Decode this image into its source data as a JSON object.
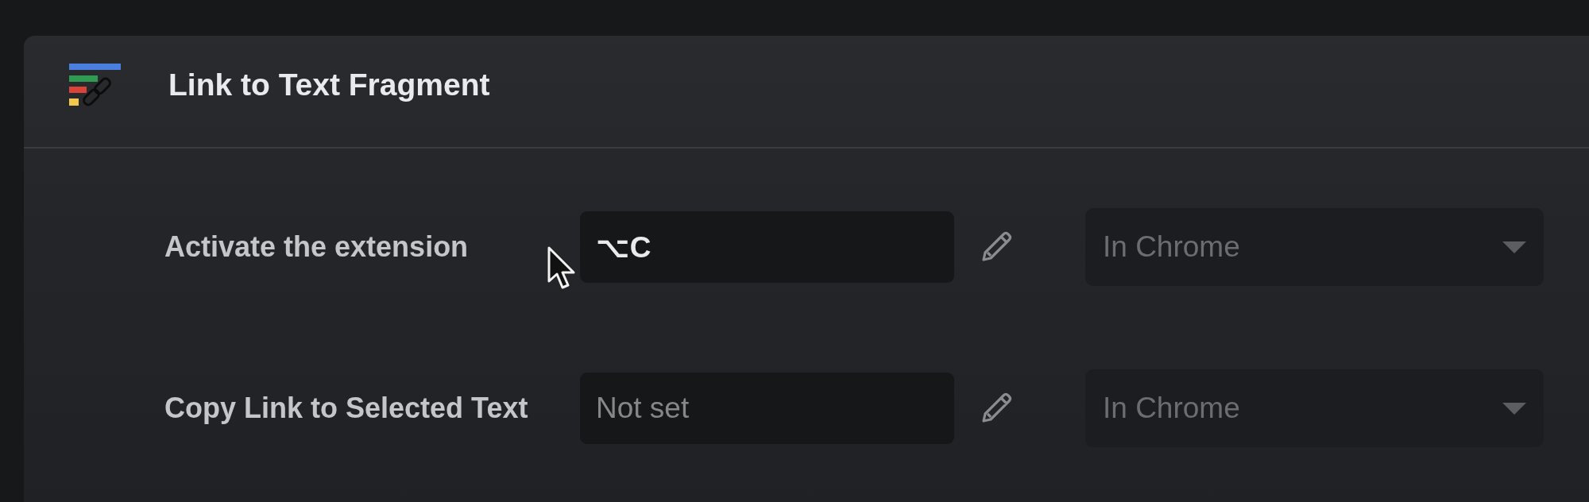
{
  "header": {
    "title": "Link to Text Fragment"
  },
  "shortcuts": [
    {
      "label": "Activate the extension",
      "shortcut": {
        "value": "⌥C"
      },
      "scope": {
        "value": "In Chrome",
        "disabled": true
      }
    },
    {
      "label": "Copy Link to Selected Text",
      "shortcut": {
        "placeholder": "Not set"
      },
      "scope": {
        "value": "In Chrome",
        "disabled": true
      }
    }
  ]
}
